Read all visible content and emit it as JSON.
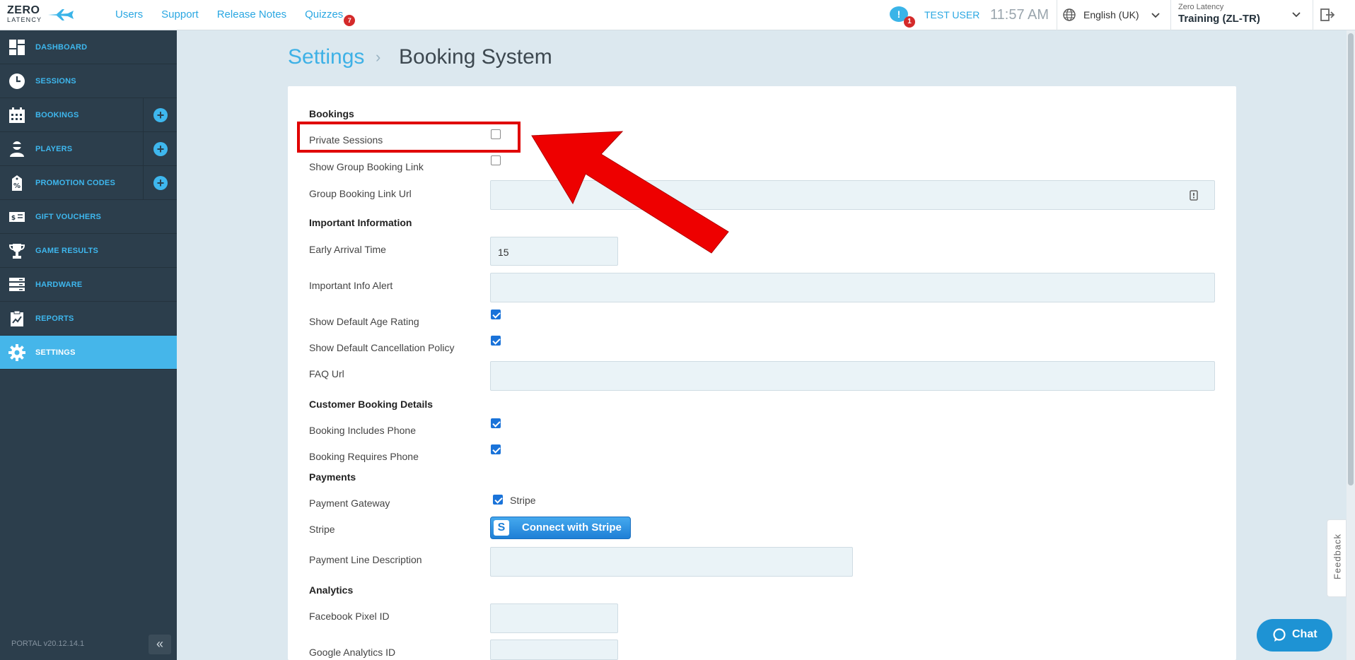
{
  "brand": {
    "line1": "ZERO",
    "line2": "LATENCY"
  },
  "topnav": [
    {
      "label": "Users"
    },
    {
      "label": "Support"
    },
    {
      "label": "Release Notes"
    },
    {
      "label": "Quizzes",
      "badge": "7"
    }
  ],
  "header": {
    "notif_symbol": "!",
    "notif_count": "1",
    "user": "TEST USER",
    "time": "11:57 AM",
    "language": "English (UK)",
    "org_name": "Zero Latency",
    "org_site": "Training (ZL-TR)"
  },
  "sidebar": {
    "items": [
      {
        "label": "DASHBOARD",
        "icon": "dashboard-icon"
      },
      {
        "label": "SESSIONS",
        "icon": "clock-icon"
      },
      {
        "label": "BOOKINGS",
        "icon": "calendar-icon",
        "plus": "+"
      },
      {
        "label": "PLAYERS",
        "icon": "player-icon",
        "plus": "+"
      },
      {
        "label": "PROMOTION CODES",
        "icon": "promo-icon",
        "plus": "+"
      },
      {
        "label": "GIFT VOUCHERS",
        "icon": "voucher-icon"
      },
      {
        "label": "GAME RESULTS",
        "icon": "trophy-icon"
      },
      {
        "label": "HARDWARE",
        "icon": "server-icon"
      },
      {
        "label": "REPORTS",
        "icon": "report-icon"
      },
      {
        "label": "SETTINGS",
        "icon": "gear-icon",
        "active": true
      }
    ],
    "version": "PORTAL v20.12.14.1",
    "collapse": "«"
  },
  "breadcrumb": {
    "parent": "Settings",
    "sep": "›",
    "current": "Booking System"
  },
  "form": {
    "bookings_header": "Bookings",
    "private_sessions": "Private Sessions",
    "private_sessions_checked": false,
    "show_group_link": "Show Group Booking Link",
    "show_group_link_checked": false,
    "group_link_url": "Group Booking Link Url",
    "group_link_url_value": "",
    "important_header": "Important Information",
    "early_arrival": "Early Arrival Time",
    "early_arrival_value": "15",
    "important_alert": "Important Info Alert",
    "important_alert_value": "",
    "age_rating": "Show Default Age Rating",
    "age_rating_checked": true,
    "cancellation": "Show Default Cancellation Policy",
    "cancellation_checked": true,
    "faq_url": "FAQ Url",
    "faq_url_value": "",
    "customer_header": "Customer Booking Details",
    "includes_phone": "Booking Includes Phone",
    "includes_phone_checked": true,
    "requires_phone": "Booking Requires Phone",
    "requires_phone_checked": true,
    "payments_header": "Payments",
    "gateway": "Payment Gateway",
    "gateway_option": "Stripe",
    "gateway_checked": true,
    "stripe": "Stripe",
    "stripe_button_s": "S",
    "stripe_button": "Connect with Stripe",
    "payment_desc": "Payment Line Description",
    "payment_desc_value": "",
    "analytics_header": "Analytics",
    "fb_pixel": "Facebook Pixel ID",
    "fb_pixel_value": "",
    "ga_id": "Google Analytics ID",
    "ga_id_value": ""
  },
  "widgets": {
    "feedback": "Feedback",
    "chat": "Chat"
  },
  "colors": {
    "accent": "#3eb7ee",
    "sidebar": "#2c3e4c",
    "highlight": "#e00000"
  }
}
